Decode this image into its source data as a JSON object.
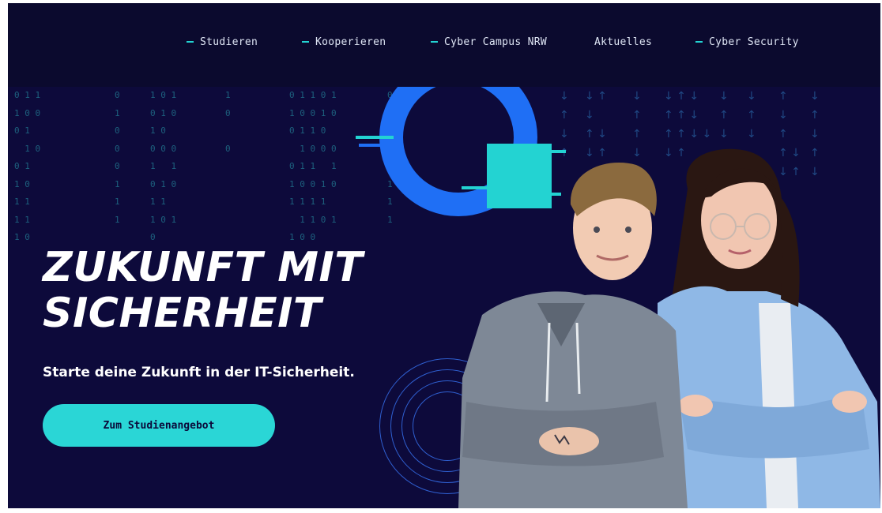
{
  "nav": {
    "items": [
      {
        "label": "Studieren",
        "dash": true
      },
      {
        "label": "Kooperieren",
        "dash": true
      },
      {
        "label": "Cyber Campus NRW",
        "dash": true
      },
      {
        "label": "Aktuelles",
        "dash": false
      },
      {
        "label": "Cyber Security",
        "dash": true
      }
    ]
  },
  "hero": {
    "headline_line1": "ZUKUNFT MIT",
    "headline_line2": "SICHERHEIT",
    "subline": "Starte deine Zukunft in der IT-Sicherheit.",
    "cta_label": "Zum Studienangebot"
  },
  "colors": {
    "background": "#0d0a3b",
    "topbar": "#0b0a2e",
    "accent_cyan": "#2ad6d6",
    "accent_blue": "#1f6ff5",
    "text": "#ffffff"
  }
}
